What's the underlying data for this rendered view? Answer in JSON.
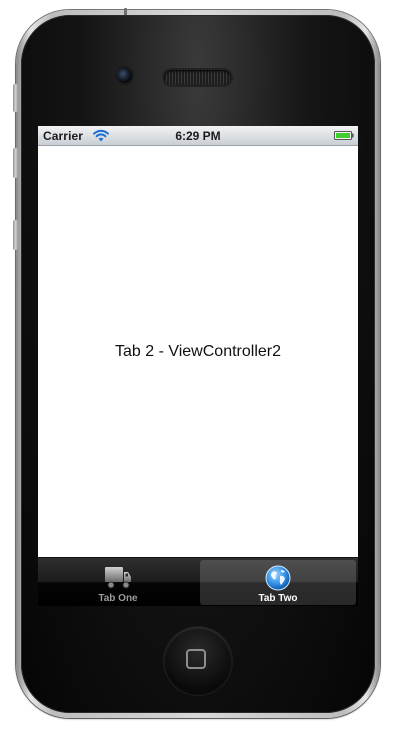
{
  "status_bar": {
    "carrier": "Carrier",
    "time": "6:29 PM",
    "wifi_icon": "wifi-icon",
    "battery_icon": "battery-icon",
    "battery_color": "#3ecf2c"
  },
  "content": {
    "label": "Tab 2 - ViewController2"
  },
  "tab_bar": {
    "tabs": [
      {
        "label": "Tab One",
        "icon": "truck-icon",
        "selected": false
      },
      {
        "label": "Tab Two",
        "icon": "globe-icon",
        "selected": true
      }
    ]
  },
  "colors": {
    "tab_selected_highlight": "#4aa3ff",
    "tab_unselected": "#9b9b9b"
  }
}
